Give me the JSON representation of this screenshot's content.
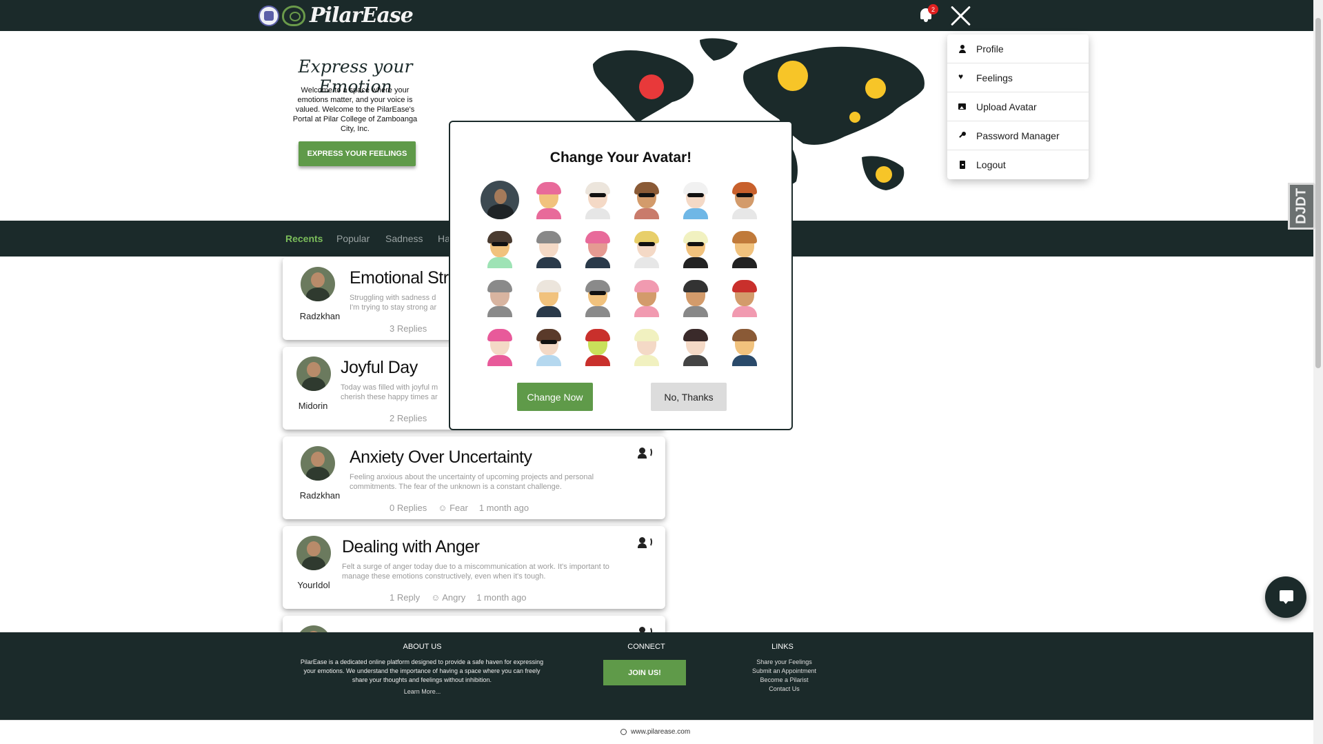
{
  "header": {
    "brand": "PilarEase",
    "notification_count": "2"
  },
  "hero": {
    "title": "Express your Emotion",
    "text": "Welcome to a space where your emotions matter, and your voice is valued. Welcome to the PilarEase's Portal at Pilar College of Zamboanga City, Inc.",
    "button": "EXPRESS YOUR FEELINGS"
  },
  "tabs": [
    "Recents",
    "Popular",
    "Sadness",
    "Ha"
  ],
  "posts": [
    {
      "user": "Radzkhan",
      "title": "Emotional Str",
      "desc": "Struggling with sadness d\nI'm trying to stay strong ar",
      "replies": "3 Replies",
      "emotion": "",
      "time": ""
    },
    {
      "user": "Midorin",
      "title": "Joyful Day",
      "desc": "Today was filled with joyful m\ncherish these happy times ar",
      "replies": "2 Replies",
      "emotion": "",
      "time": ""
    },
    {
      "user": "Radzkhan",
      "title": "Anxiety Over Uncertainty",
      "desc": "Feeling anxious about the uncertainty of upcoming projects and personal commitments. The fear of the unknown is a constant challenge.",
      "replies": "0 Replies",
      "emotion": "Fear",
      "time": "1 month ago"
    },
    {
      "user": "YourIdol",
      "title": "Dealing with Anger",
      "desc": "Felt a surge of anger today due to a miscommunication at work. It's important to manage these emotions constructively, even when it's tough.",
      "replies": "1 Reply",
      "emotion": "Angry",
      "time": "1 month ago"
    }
  ],
  "dropdown": {
    "items": [
      {
        "label": "Profile",
        "icon": "person-icon"
      },
      {
        "label": "Feelings",
        "icon": "heart-icon"
      },
      {
        "label": "Upload Avatar",
        "icon": "image-icon"
      },
      {
        "label": "Password Manager",
        "icon": "key-icon"
      },
      {
        "label": "Logout",
        "icon": "logout-icon"
      }
    ]
  },
  "modal": {
    "title": "Change Your Avatar!",
    "change_label": "Change Now",
    "cancel_label": "No, Thanks"
  },
  "footer": {
    "about_heading": "ABOUT US",
    "about_text": "PilarEase is a dedicated online platform designed to provide a safe haven for expressing your emotions. We understand the importance of having a space where you can freely share your thoughts and feelings without inhibition.",
    "learn_more": "Learn More...",
    "connect_heading": "CONNECT",
    "join_label": "JOIN US!",
    "links_heading": "LINKS",
    "links": [
      "Share your Feelings",
      "Submit an Appointment",
      "Become a Pilarist",
      "Contact Us"
    ],
    "url": "www.pilarease.com"
  },
  "side_tab": "DJDT",
  "colors": {
    "dark": "#1b2a2a",
    "green": "#5f9a49",
    "accent_tab": "#7bbd5b"
  }
}
